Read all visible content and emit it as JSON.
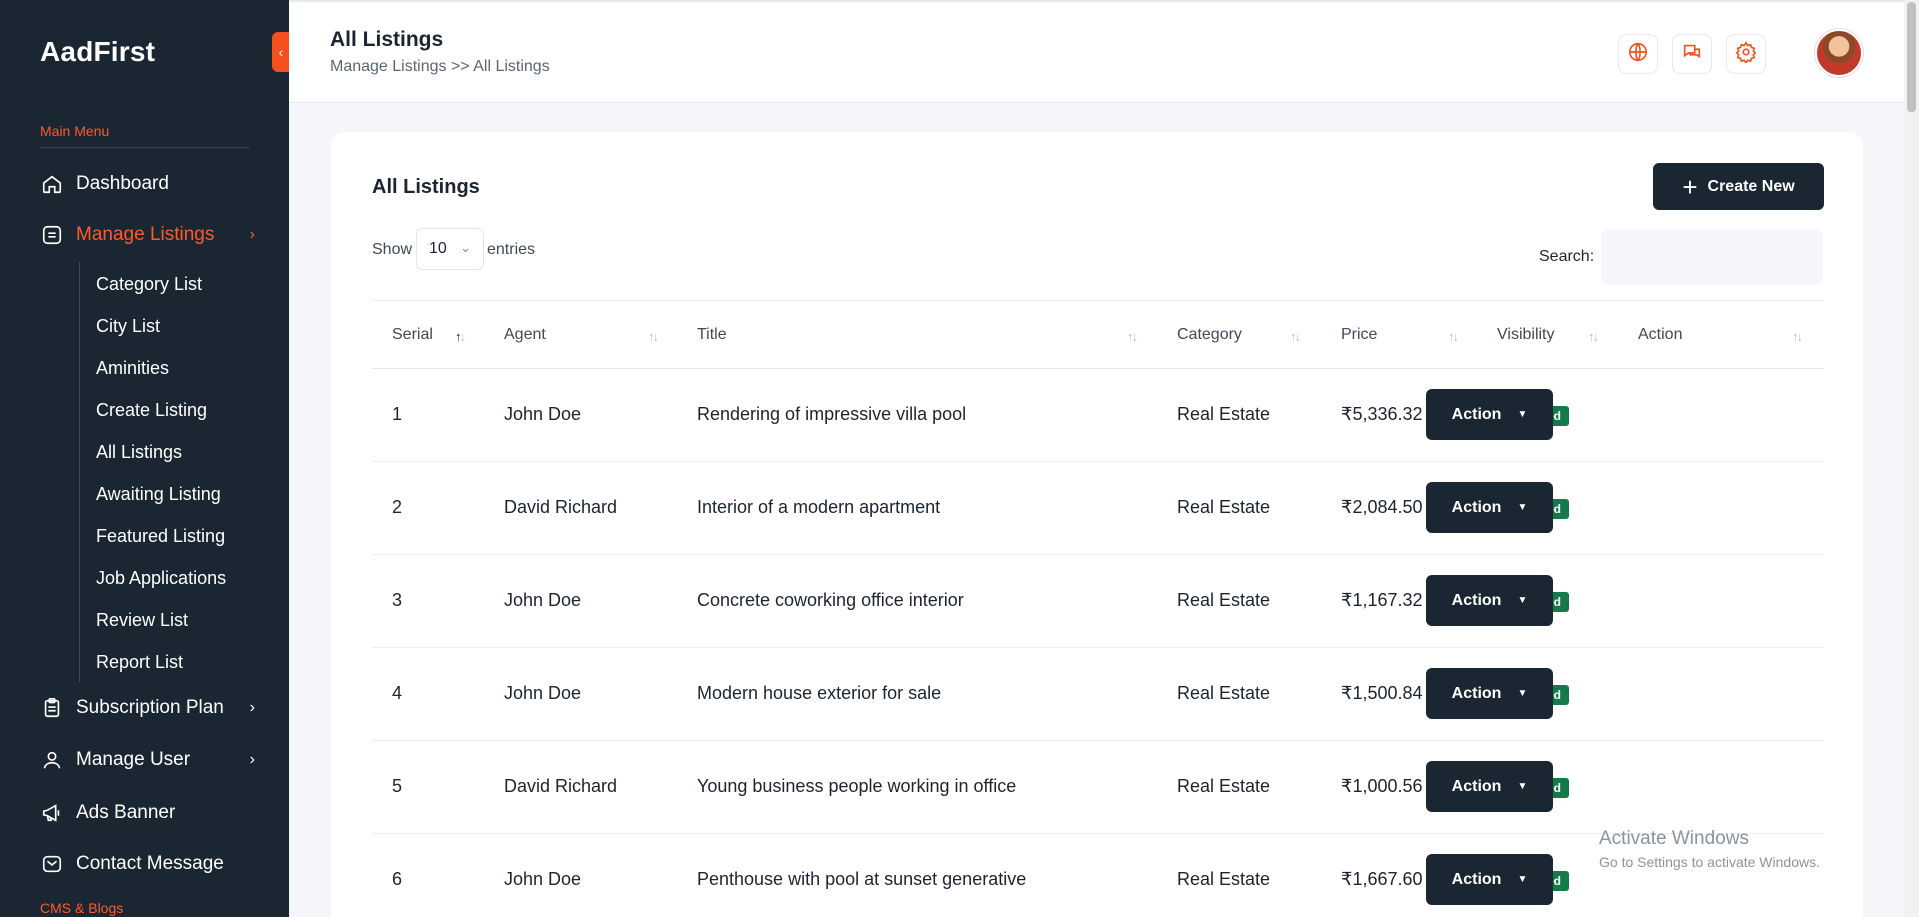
{
  "sidebar": {
    "brand": "AadFirst",
    "main_menu_label": "Main Menu",
    "cms_label": "CMS & Blogs",
    "items": [
      {
        "label": "Dashboard",
        "icon": "home-icon"
      },
      {
        "label": "Manage Listings",
        "icon": "list-icon",
        "active": true
      },
      {
        "label": "Subscription Plan",
        "icon": "clipboard-icon"
      },
      {
        "label": "Manage User",
        "icon": "user-icon"
      },
      {
        "label": "Ads Banner",
        "icon": "megaphone-icon"
      },
      {
        "label": "Contact Message",
        "icon": "mail-icon"
      }
    ],
    "submenu": [
      "Category List",
      "City List",
      "Aminities",
      "Create Listing",
      "All Listings",
      "Awaiting Listing",
      "Featured Listing",
      "Job Applications",
      "Review List",
      "Report List"
    ]
  },
  "header": {
    "title": "All Listings",
    "breadcrumb": "Manage Listings >> All Listings",
    "icons": [
      "globe-icon",
      "chat-icon",
      "gear-icon"
    ],
    "accent": "#f4511e"
  },
  "card": {
    "title": "All Listings",
    "create_label": "Create New",
    "show_label": "Show",
    "entries_value": "10",
    "entries_label": "entries",
    "search_label": "Search:"
  },
  "table": {
    "columns": [
      "Serial",
      "Agent",
      "Title",
      "Category",
      "Price",
      "Visibility",
      "Action"
    ],
    "rows": [
      {
        "serial": "1",
        "agent": "John Doe",
        "title": "Rendering of impressive villa pool",
        "category": "Real Estate",
        "price": "₹5,336.32",
        "visibility": "Approved",
        "action": "Action"
      },
      {
        "serial": "2",
        "agent": "David Richard",
        "title": "Interior of a modern apartment",
        "category": "Real Estate",
        "price": "₹2,084.50",
        "visibility": "Approved",
        "action": "Action"
      },
      {
        "serial": "3",
        "agent": "John Doe",
        "title": "Concrete coworking office interior",
        "category": "Real Estate",
        "price": "₹1,167.32",
        "visibility": "Approved",
        "action": "Action"
      },
      {
        "serial": "4",
        "agent": "John Doe",
        "title": "Modern house exterior for sale",
        "category": "Real Estate",
        "price": "₹1,500.84",
        "visibility": "Approved",
        "action": "Action"
      },
      {
        "serial": "5",
        "agent": "David Richard",
        "title": "Young business people working in office",
        "category": "Real Estate",
        "price": "₹1,000.56",
        "visibility": "Approved",
        "action": "Action"
      },
      {
        "serial": "6",
        "agent": "John Doe",
        "title": "Penthouse with pool at sunset generative",
        "category": "Real Estate",
        "price": "₹1,667.60",
        "visibility": "Approved",
        "action": "Action"
      }
    ],
    "badge_color": "#157a4a"
  },
  "watermark": {
    "line1": "Activate Windows",
    "line2": "Go to Settings to activate Windows."
  }
}
